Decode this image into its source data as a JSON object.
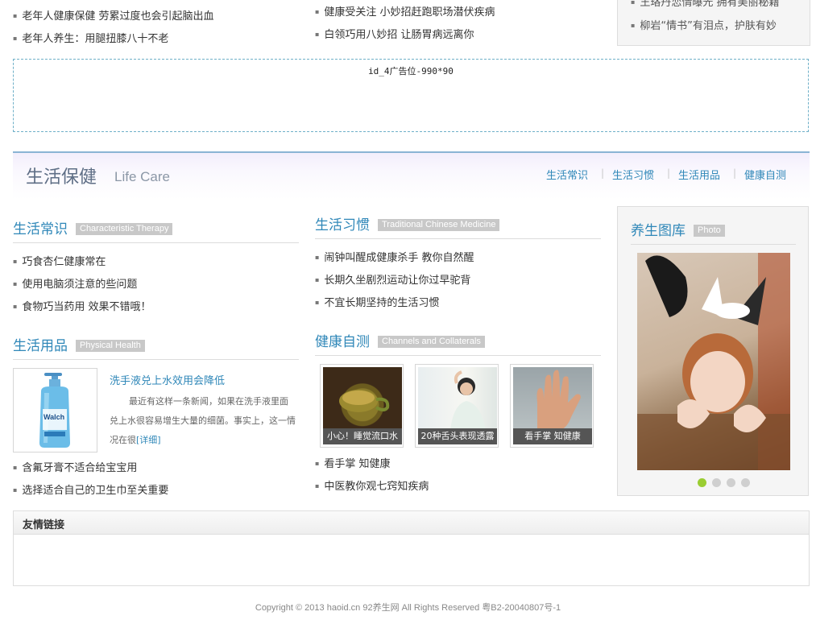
{
  "top": {
    "col1": [
      "老年人健康保健 劳累过度也会引起脑出血",
      "老年人养生：用腿扭膝八十不老"
    ],
    "col2": [
      "健康受关注 小妙招赶跑职场潜伏疾病",
      "白领巧用八妙招 让肠胃病远离你"
    ],
    "col3": [
      "王珞丹恋情曝光 拥有美丽秘籍",
      "柳岩“情书”有泪点，护肤有妙"
    ]
  },
  "ad": {
    "label": "id_4广告位-990*90"
  },
  "section": {
    "title": "生活保健",
    "subtitle": "Life Care",
    "nav": [
      "生活常识",
      "生活习惯",
      "生活用品",
      "健康自测"
    ],
    "separator": "|"
  },
  "changshi": {
    "title": "生活常识",
    "tag": "Characteristic Therapy",
    "items": [
      "巧食杏仁健康常在",
      "使用电脑须注意的些问题",
      "食物巧当药用 效果不错哦！"
    ]
  },
  "yongpin": {
    "title": "生活用品",
    "tag": "Physical Health",
    "feature_title": "洗手液兑上水效用会降低",
    "feature_text": "最近有这样一条新闻，如果在洗手液里面兑上水很容易增生大量的细菌。事实上，这一情况在很",
    "feature_more": "[详细]",
    "product_brand": "Walch",
    "items": [
      "含氟牙膏不适合给宝宝用",
      "选择适合自己的卫生巾至关重要"
    ]
  },
  "xiguan": {
    "title": "生活习惯",
    "tag": "Traditional Chinese Medicine",
    "items": [
      "闹钟叫醒成健康杀手 教你自然醒",
      "长期久坐剧烈运动让你过早驼背",
      "不宜长期坚持的生活习惯"
    ]
  },
  "zice": {
    "title": "健康自测",
    "tag": "Channels and Collaterals",
    "thumbs": [
      "小心！睡觉流口水",
      "20种舌头表现透露",
      "看手掌 知健康"
    ],
    "items": [
      "看手掌 知健康",
      "中医教你观七窍知疾病"
    ]
  },
  "gallery": {
    "title": "养生图库",
    "tag": "Photo",
    "dots": 4,
    "active_dot": 1
  },
  "links": {
    "title": "友情链接"
  },
  "footer": {
    "text": "Copyright © 2013 haoid.cn 92养生网 All Rights Reserved 粤B2-20040807号-1"
  },
  "colors": {
    "accent_blue": "#2f87b8",
    "tag_gray": "#c8c8c8",
    "active_dot": "#9acd32"
  }
}
